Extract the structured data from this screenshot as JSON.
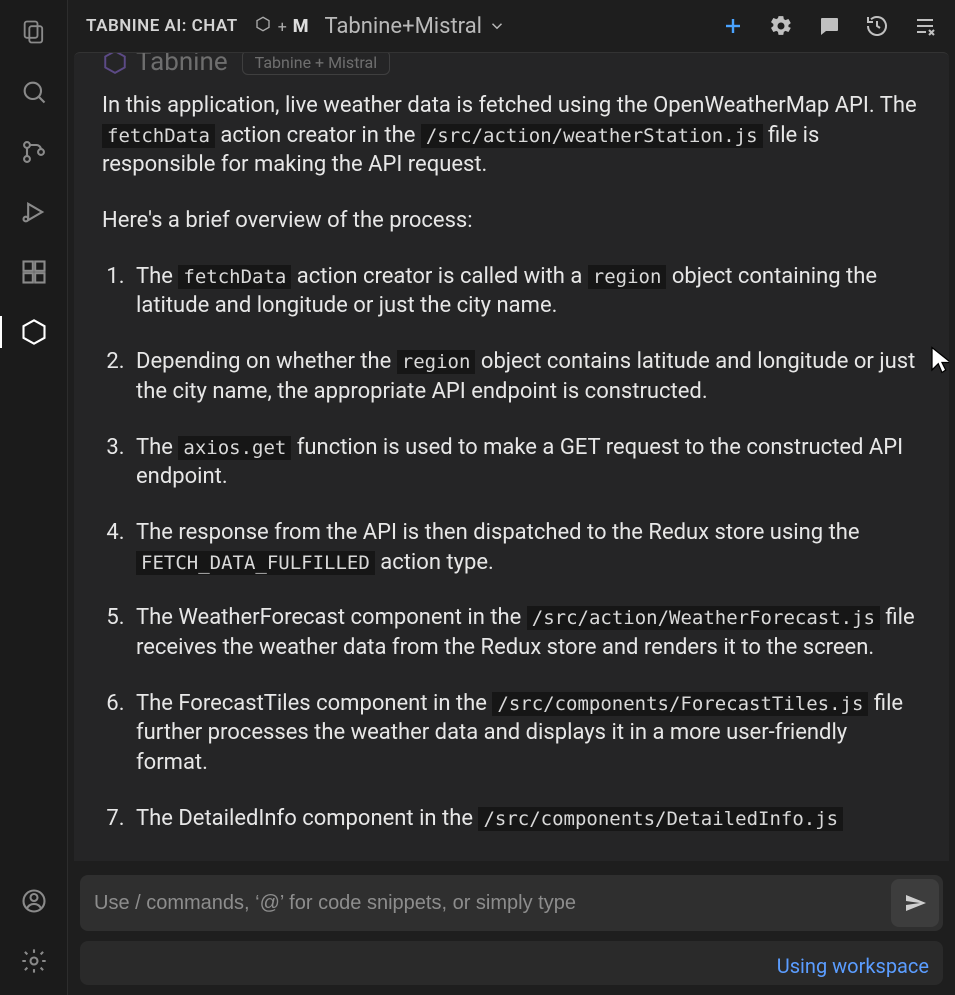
{
  "header": {
    "title": "TABNINE AI: CHAT",
    "model": "Tabnine+Mistral"
  },
  "assistant": {
    "name": "Tabnine",
    "chip": "Tabnine + Mistral"
  },
  "prose": {
    "p1_pre": "In this application, live weather data is fetched using the OpenWeatherMap API. The ",
    "p1_code1": "fetchData",
    "p1_mid1": " action creator in the ",
    "p1_code2": "/src/action/weatherStation.js",
    "p1_post": " file is responsible for making the API request.",
    "p2": "Here's a brief overview of the process:",
    "li1_pre": "The ",
    "li1_code1": "fetchData",
    "li1_mid1": " action creator is called with a ",
    "li1_code2": "region",
    "li1_post": " object containing the latitude and longitude or just the city name.",
    "li2_pre": "Depending on whether the ",
    "li2_code1": "region",
    "li2_post": " object contains latitude and longitude or just the city name, the appropriate API endpoint is constructed.",
    "li3_pre": "The ",
    "li3_code1": "axios.get",
    "li3_post": " function is used to make a GET request to the constructed API endpoint.",
    "li4_pre": "The response from the API is then dispatched to the Redux store using the ",
    "li4_code1": "FETCH_DATA_FULFILLED",
    "li4_post": " action type.",
    "li5_pre": "The WeatherForecast component in the ",
    "li5_code1": "/src/action/WeatherForecast.js",
    "li5_post": " file receives the weather data from the Redux store and renders it to the screen.",
    "li6_pre": "The ForecastTiles component in the ",
    "li6_code1": "/src/components/ForecastTiles.js",
    "li6_post": " file further processes the weather data and displays it in a more user-friendly format.",
    "li7_pre": "The DetailedInfo component in the ",
    "li7_code1": "/src/components/DetailedInfo.js"
  },
  "input": {
    "placeholder": "Use / commands, ‘@’ for code snippets, or simply type"
  },
  "footer": {
    "workspace": "Using workspace"
  }
}
